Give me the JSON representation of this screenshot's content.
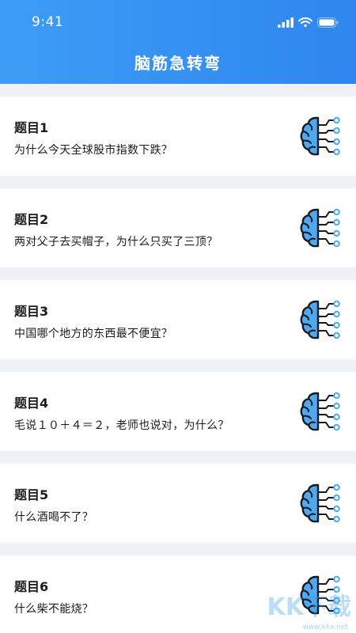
{
  "status_bar": {
    "time": "9:41"
  },
  "header": {
    "title": "脑筋急转弯"
  },
  "questions": [
    {
      "title": "题目1",
      "text": "为什么今天全球股市指数下跌？"
    },
    {
      "title": "题目2",
      "text": "两对父子去买帽子，为什么只买了三顶？"
    },
    {
      "title": "题目3",
      "text": "中国哪个地方的东西最不便宜？"
    },
    {
      "title": "题目4",
      "text": "毛说１０＋４＝２，老师也说对，为什么？"
    },
    {
      "title": "题目5",
      "text": "什么酒喝不了？"
    },
    {
      "title": "题目6",
      "text": "什么柴不能烧？"
    }
  ],
  "icon": {
    "name": "brain-circuit-icon",
    "fill": "#4ea8f2",
    "stroke": "#1a1a1a"
  },
  "colors": {
    "header": "#3d9df6",
    "background": "#eef1f5"
  },
  "watermark": {
    "text": "KK下载",
    "url": "www.kkx.net"
  }
}
